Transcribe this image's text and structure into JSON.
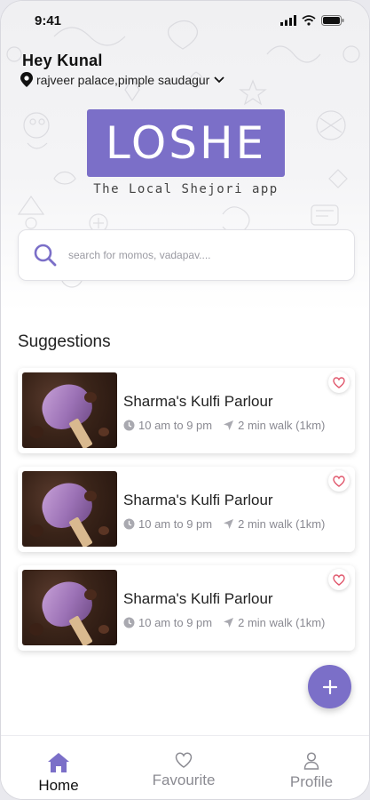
{
  "status_bar": {
    "time": "9:41"
  },
  "header": {
    "greeting": "Hey Kunal",
    "location": "rajveer palace,pimple saudagur"
  },
  "brand": {
    "logo": "LOSHE",
    "tagline": "The Local Shejori app",
    "color": "#7b6fc8"
  },
  "search": {
    "placeholder": "search for momos, vadapav....",
    "value": ""
  },
  "suggestions": {
    "title": "Suggestions",
    "items": [
      {
        "name": "Sharma's Kulfi Parlour",
        "hours": "10 am to 9 pm",
        "distance": "2 min walk (1km)"
      },
      {
        "name": "Sharma's Kulfi Parlour",
        "hours": "10 am to 9 pm",
        "distance": "2 min walk (1km)"
      },
      {
        "name": "Sharma's Kulfi Parlour",
        "hours": "10 am to 9 pm",
        "distance": "2 min walk (1km)"
      }
    ]
  },
  "fab": {
    "icon": "plus-icon"
  },
  "nav": {
    "home": "Home",
    "favourite": "Favourite",
    "profile": "Profile",
    "active": "home"
  },
  "colors": {
    "accent": "#7b6fc8",
    "heart": "#e0566b",
    "text_muted": "#8a8a92"
  }
}
